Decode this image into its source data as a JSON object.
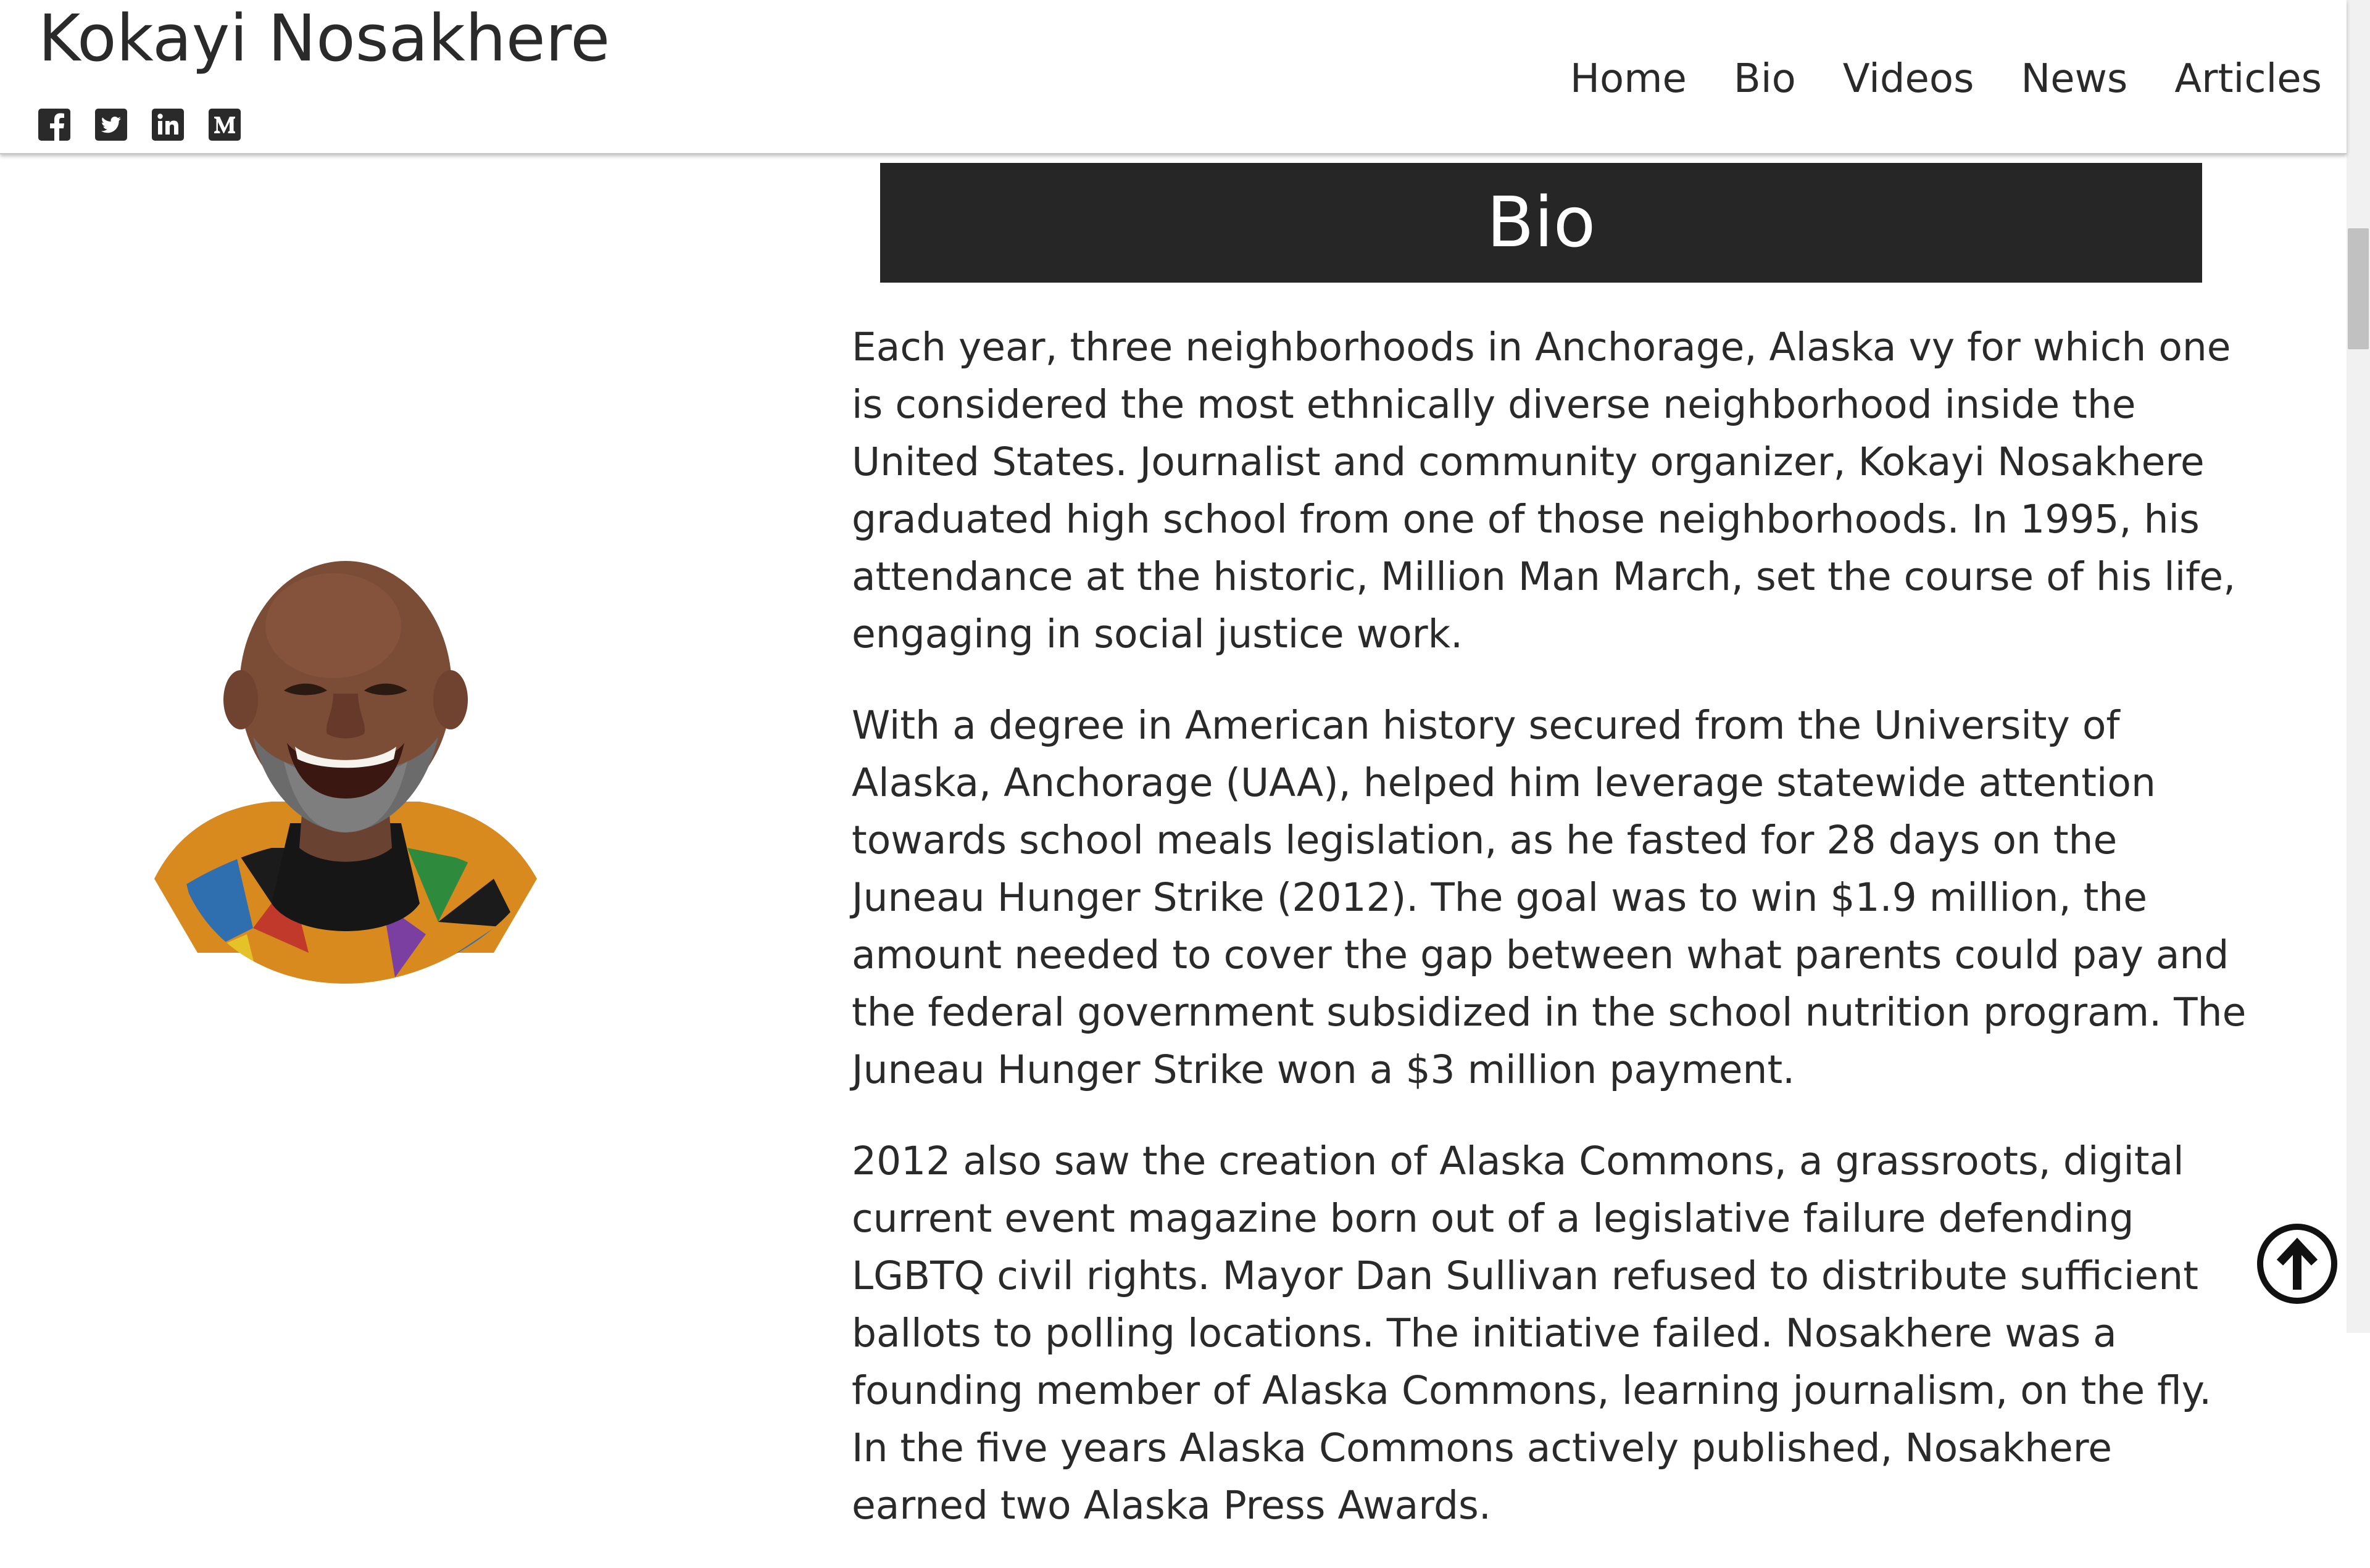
{
  "site": {
    "title": "Kokayi Nosakhere"
  },
  "socials": [
    {
      "icon": "facebook-icon",
      "glyph": "f"
    },
    {
      "icon": "twitter-icon",
      "glyph": "t"
    },
    {
      "icon": "linkedin-icon",
      "glyph": "in"
    },
    {
      "icon": "medium-icon",
      "glyph": "M"
    }
  ],
  "nav": {
    "home": "Home",
    "bio": "Bio",
    "videos": "Videos",
    "news": "News",
    "articles": "Articles"
  },
  "section": {
    "heading": "Bio"
  },
  "paragraphs": {
    "p1": "Each year, three neighborhoods in Anchorage, Alaska vy for which one is considered the most ethnically diverse neighborhood inside the United States. Journalist and community organizer, Kokayi Nosakhere graduated high school from one of those neighborhoods. In 1995, his attendance at the historic, Million Man March, set the course of his life, engaging in social justice work.",
    "p2": "With a degree in American history secured from the University of Alaska, Anchorage (UAA), helped him leverage statewide attention towards school meals legislation, as he fasted for 28 days on the Juneau Hunger Strike (2012). The goal was to win $1.9 million, the amount needed to cover the gap between what parents could pay and the federal government subsidized in the school nutrition program. The Juneau Hunger Strike won a $3 million payment.",
    "p3": "2012 also saw the creation of Alaska Commons, a grassroots, digital current event magazine born out of a legislative failure defending LGBTQ civil rights. Mayor Dan Sullivan refused to distribute sufficient ballots to polling locations. The initiative failed. Nosakhere was a founding member of Alaska Commons, learning journalism, on the fly. In the five years Alaska Commons actively published, Nosakhere earned two Alaska Press Awards."
  },
  "colors": {
    "text": "#2a2a2a",
    "banner": "#262626",
    "banner_text": "#ffffff",
    "background": "#ffffff"
  }
}
